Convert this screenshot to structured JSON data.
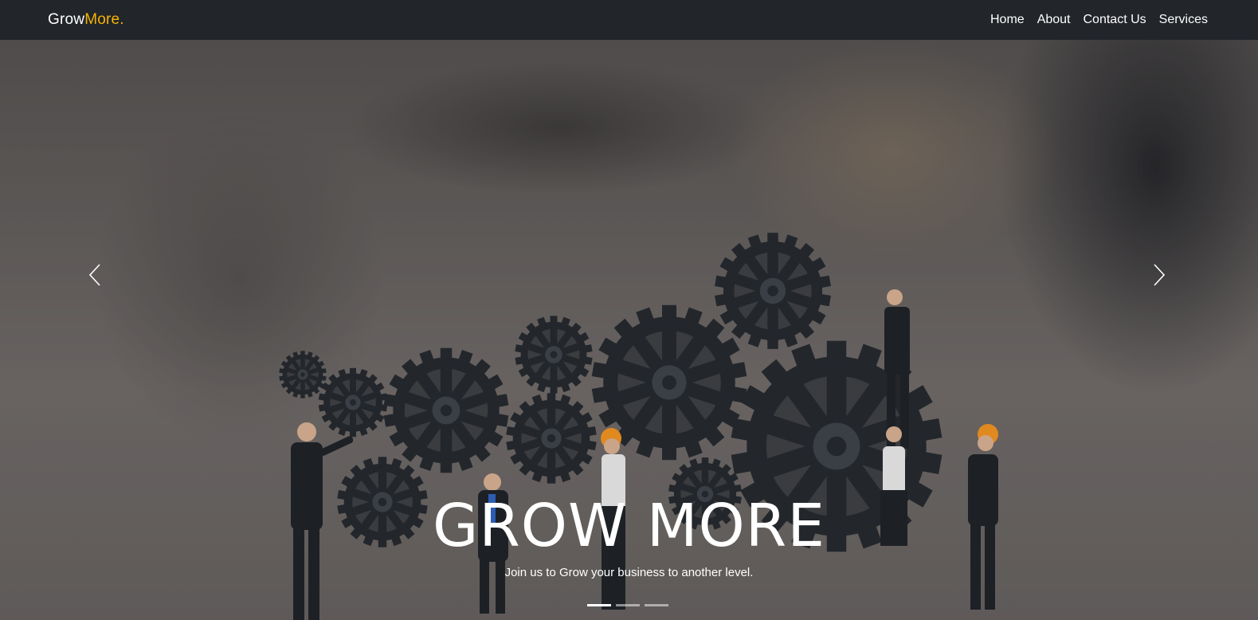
{
  "navbar": {
    "brand_main": "Grow",
    "brand_accent": "More.",
    "links": [
      "Home",
      "About",
      "Contact Us",
      "Services"
    ]
  },
  "hero": {
    "title": "GROW MORE",
    "subtitle": "Join us to Grow your business to another level.",
    "prev_icon": "chevron-left-icon",
    "next_icon": "chevron-right-icon",
    "slides_count": 3,
    "active_slide": 1
  },
  "colors": {
    "navbar_bg": "#22252a",
    "brand_accent": "#f5b400",
    "text": "#ffffff"
  }
}
